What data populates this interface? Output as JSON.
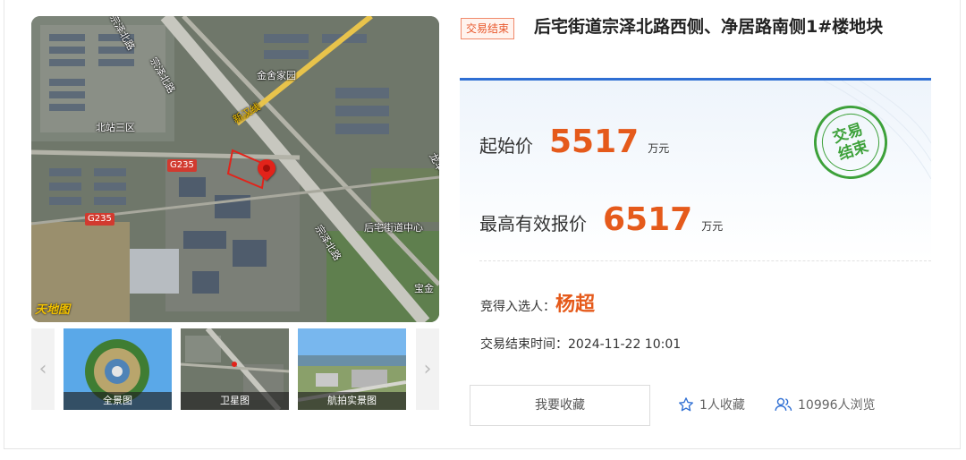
{
  "map": {
    "labels": {
      "zongze_road_top": "宗泽北路",
      "zongze_road_left": "宗泽北路",
      "zongze_road_lower": "宗泽北路",
      "jinyuan": "金舍家园",
      "xinhan_line": "新汉线",
      "beizhan_district": "北站三区",
      "houzhai_center": "后宅街道中心",
      "baojin": "宝金",
      "dragon_road": "龙华路",
      "g235_a": "G235",
      "g235_b": "G235",
      "brand": "天地图"
    }
  },
  "thumbnails": [
    {
      "label": "全景图"
    },
    {
      "label": "卫星图"
    },
    {
      "label": "航拍实景图"
    }
  ],
  "nav": {
    "prev": "‹",
    "next": "›"
  },
  "status_tag": "交易结束",
  "title": "后宅街道宗泽北路西侧、净居路南侧1#楼地块",
  "start_price": {
    "label": "起始价",
    "value": "5517",
    "unit": "万元"
  },
  "highest_price": {
    "label": "最高有效报价",
    "value": "6517",
    "unit": "万元"
  },
  "stamp_text": "交易结束",
  "winner": {
    "label": "竞得入选人：",
    "name": "杨超"
  },
  "end_time": {
    "label": "交易结束时间：",
    "value": "2024-11-22 10:01"
  },
  "favorite_button": "我要收藏",
  "stats": {
    "favorites": "1人收藏",
    "views": "10996人浏览"
  },
  "colors": {
    "accent_orange": "#e55a1b",
    "accent_blue": "#2f6fd3",
    "stamp_green": "#3da13a",
    "icon_blue": "#2f6fd3"
  }
}
